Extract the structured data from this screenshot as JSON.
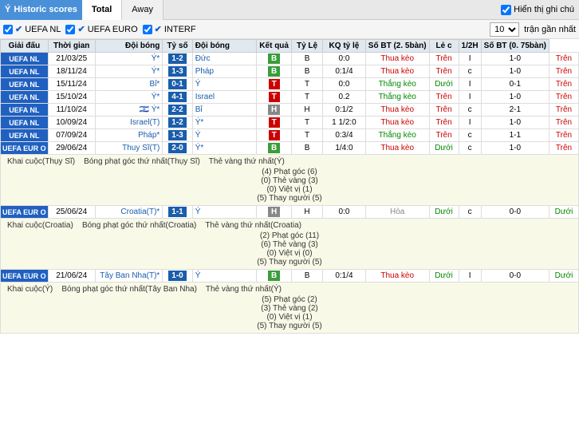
{
  "header": {
    "logo": "Ý",
    "title": "Historic scores",
    "tabs": [
      {
        "label": "Total",
        "active": true
      },
      {
        "label": "Away",
        "active": false
      }
    ],
    "show_notes_label": "Hiển thị ghi chú"
  },
  "filters": {
    "items": [
      {
        "label": "UEFA NL",
        "checked": true
      },
      {
        "label": "UEFA EURO",
        "checked": true
      },
      {
        "label": "INTERF",
        "checked": true
      }
    ],
    "select_value": "10",
    "right_label": "trận gần nhất"
  },
  "table": {
    "headers": [
      "Giải đấu",
      "Thời gian",
      "Đội bóng",
      "Tỷ số",
      "Đội bóng",
      "Kết quả",
      "Tỷ Lệ",
      "KQ tỷ lệ",
      "Số BT (2. 5bàn)",
      "Lẻ c",
      "1/2H",
      "Số BT (0. 75bàn)"
    ],
    "rows": [
      {
        "type": "match",
        "league": "UEFA NL",
        "date": "21/03/25",
        "team1": "Ý*",
        "score": "1-2",
        "team2": "Đức",
        "kq": "B",
        "tyle": "B",
        "kq_tyle": "0:0",
        "status": "Thua kèo",
        "sobt": "Trên",
        "lec": "I",
        "h1h2": "1-0",
        "sobt2": "Trên"
      },
      {
        "type": "match",
        "league": "UEFA NL",
        "date": "18/11/24",
        "team1": "Ý*",
        "score": "1-3",
        "team2": "Pháp",
        "kq": "B",
        "tyle": "B",
        "kq_tyle": "0:1/4",
        "status": "Thua kèo",
        "sobt": "Trên",
        "lec": "c",
        "h1h2": "1-0",
        "sobt2": "Trên"
      },
      {
        "type": "match",
        "league": "UEFA NL",
        "date": "15/11/24",
        "team1": "Bỉ*",
        "score": "0-1",
        "team2": "Ý",
        "kq": "T",
        "tyle": "T",
        "kq_tyle": "0:0",
        "status": "Thắng kèo",
        "sobt": "Dưới",
        "lec": "I",
        "h1h2": "0-1",
        "sobt2": "Trên"
      },
      {
        "type": "match",
        "league": "UEFA NL",
        "date": "15/10/24",
        "team1": "Ý*",
        "score": "4-1",
        "team2": "Israel",
        "kq": "T",
        "tyle": "T",
        "kq_tyle": "0.2",
        "status": "Thắng kèo",
        "sobt": "Trên",
        "lec": "I",
        "h1h2": "1-0",
        "sobt2": "Trên"
      },
      {
        "type": "match",
        "league": "UEFA NL",
        "date": "11/10/24",
        "team1": "🇮🇱 Ý*",
        "score": "2-2",
        "team2": "Bỉ",
        "kq": "H",
        "tyle": "H",
        "kq_tyle": "0:1/2",
        "status": "Thua kèo",
        "sobt": "Trên",
        "lec": "c",
        "h1h2": "2-1",
        "sobt2": "Trên"
      },
      {
        "type": "match",
        "league": "UEFA NL",
        "date": "10/09/24",
        "team1": "Israel(T)",
        "score": "1-2",
        "team2": "Ý*",
        "kq": "T",
        "tyle": "T",
        "kq_tyle": "1 1/2:0",
        "status": "Thua kèo",
        "sobt": "Trên",
        "lec": "I",
        "h1h2": "1-0",
        "sobt2": "Trên"
      },
      {
        "type": "match",
        "league": "UEFA NL",
        "date": "07/09/24",
        "team1": "Pháp*",
        "score": "1-3",
        "team2": "Ý",
        "kq": "T",
        "tyle": "T",
        "kq_tyle": "0:3/4",
        "status": "Thắng kèo",
        "sobt": "Trên",
        "lec": "c",
        "h1h2": "1-1",
        "sobt2": "Trên"
      },
      {
        "type": "match",
        "league": "UEFA EURO",
        "date": "29/06/24",
        "team1": "Thuy Sĩ(T)",
        "score": "2-0",
        "team2": "Ý*",
        "kq": "B",
        "tyle": "B",
        "kq_tyle": "1/4:0",
        "status": "Thua kèo",
        "sobt": "Dưới",
        "lec": "c",
        "h1h2": "1-0",
        "sobt2": "Trên",
        "has_detail": true,
        "detail": {
          "khai_cuoc": "Khai cuộc(Thụy Sĩ)",
          "bong_phat_goc": "Bóng phạt góc thứ nhất(Thụy Sĩ)",
          "the_vang": "Thẻ vàng thứ nhất(Ý)",
          "items": [
            "(4) Phạt góc (6)",
            "(0) Thẻ vàng (3)",
            "(0) Việt vị (1)",
            "(5) Thay người (5)"
          ]
        }
      },
      {
        "type": "match",
        "league": "UEFA EURO",
        "date": "25/06/24",
        "team1": "Croatia(T)*",
        "score": "1-1",
        "team2": "Ý",
        "kq": "H",
        "tyle": "H",
        "kq_tyle": "0:0",
        "status": "Hòa",
        "sobt": "Dưới",
        "lec": "c",
        "h1h2": "0-0",
        "sobt2": "Dưới",
        "has_detail": true,
        "detail": {
          "khai_cuoc": "Khai cuộc(Croatia)",
          "bong_phat_goc": "Bóng phạt góc thứ nhất(Croatia)",
          "the_vang": "Thẻ vàng thứ nhất(Croatia)",
          "items": [
            "(2) Phạt góc (11)",
            "(6) Thẻ vàng (3)",
            "(0) Việt vị (0)",
            "(5) Thay người (5)"
          ]
        }
      },
      {
        "type": "match",
        "league": "UEFA EURO",
        "date": "21/06/24",
        "team1": "Tây Ban Nha(T)*",
        "score": "1-0",
        "team2": "Ý",
        "kq": "B",
        "tyle": "B",
        "kq_tyle": "0:1/4",
        "status": "Thua kèo",
        "sobt": "Dưới",
        "lec": "I",
        "h1h2": "0-0",
        "sobt2": "Dưới",
        "has_detail": true,
        "detail": {
          "khai_cuoc": "Khai cuộc(Ý)",
          "bong_phat_goc": "Bóng phạt góc thứ nhất(Tây Ban Nha)",
          "the_vang": "Thẻ vàng thứ nhất(Ý)",
          "items": [
            "(5) Phạt góc (2)",
            "(3) Thẻ vàng (2)",
            "(0) Việt vị (1)",
            "(5) Thay người (5)"
          ]
        }
      }
    ]
  }
}
